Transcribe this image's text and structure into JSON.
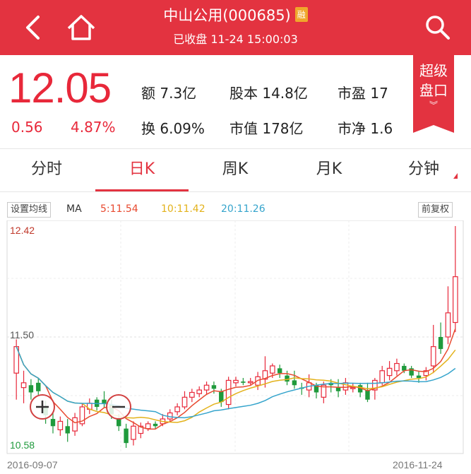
{
  "header": {
    "title": "中山公用(000685)",
    "badge": "融",
    "subtitle": "已收盘 11-24 15:00:03",
    "back_icon": "chevron-left-icon",
    "home_icon": "home-icon",
    "search_icon": "search-icon"
  },
  "quote": {
    "price": "12.05",
    "change": "0.56",
    "change_pct": "4.87%",
    "stats": [
      {
        "label": "额",
        "value": "7.3亿"
      },
      {
        "label": "股本",
        "value": "14.8亿"
      },
      {
        "label": "市盈",
        "value": "17"
      },
      {
        "label": "换",
        "value": "6.09%"
      },
      {
        "label": "市值",
        "value": "178亿"
      },
      {
        "label": "市净",
        "value": "1.6"
      }
    ],
    "super_panel": "超级盘口"
  },
  "tabs": [
    "分时",
    "日K",
    "周K",
    "月K",
    "分钟"
  ],
  "active_tab": "日K",
  "indicators": {
    "settings_button": "设置均线",
    "ma_label": "MA",
    "ma5": "5:11.54",
    "ma10": "10:11.42",
    "ma20": "20:11.26",
    "adjust_button": "前复权"
  },
  "colors": {
    "brand_red": "#e33340",
    "up": "#e8283a",
    "down": "#1f9a3c",
    "ma5": "#e8492f",
    "ma10": "#e3b21b",
    "ma20": "#35a4cc"
  },
  "chart_data": {
    "type": "candlestick",
    "y_ticks": [
      "12.42",
      "11.50",
      "10.58"
    ],
    "ylim": [
      10.58,
      12.42
    ],
    "x_start": "2016-09-07",
    "x_end": "2016-11-24",
    "candles": [
      [
        11.2,
        11.42,
        10.98,
        11.48,
        "up"
      ],
      [
        11.08,
        11.12,
        10.95,
        11.22,
        "up"
      ],
      [
        11.1,
        11.04,
        10.98,
        11.15,
        "down"
      ],
      [
        11.12,
        11.05,
        11.02,
        11.16,
        "down"
      ],
      [
        10.92,
        10.85,
        10.78,
        10.97,
        "down"
      ],
      [
        10.82,
        10.76,
        10.7,
        10.88,
        "down"
      ],
      [
        10.73,
        10.8,
        10.68,
        10.84,
        "up"
      ],
      [
        10.76,
        10.7,
        10.63,
        10.82,
        "down"
      ],
      [
        10.72,
        10.83,
        10.68,
        10.87,
        "up"
      ],
      [
        10.78,
        10.92,
        10.76,
        10.95,
        "up"
      ],
      [
        10.9,
        10.95,
        10.86,
        10.99,
        "up"
      ],
      [
        10.98,
        10.92,
        10.89,
        11.0,
        "down"
      ],
      [
        10.98,
        10.95,
        10.91,
        11.05,
        "down"
      ],
      [
        10.94,
        10.86,
        10.82,
        10.98,
        "down"
      ],
      [
        10.82,
        10.76,
        10.72,
        10.86,
        "down"
      ],
      [
        10.74,
        10.62,
        10.58,
        10.78,
        "down"
      ],
      [
        10.65,
        10.76,
        10.6,
        10.8,
        "up"
      ],
      [
        10.7,
        10.76,
        10.66,
        10.79,
        "up"
      ],
      [
        10.74,
        10.78,
        10.72,
        10.8,
        "up"
      ],
      [
        10.78,
        10.76,
        10.74,
        10.8,
        "down"
      ],
      [
        10.78,
        10.82,
        10.76,
        10.86,
        "up"
      ],
      [
        10.82,
        10.87,
        10.8,
        10.9,
        "up"
      ],
      [
        10.88,
        10.92,
        10.85,
        10.95,
        "up"
      ],
      [
        10.92,
        11.0,
        10.9,
        11.05,
        "up"
      ],
      [
        11.0,
        11.04,
        10.96,
        11.07,
        "up"
      ],
      [
        11.03,
        11.06,
        11.0,
        11.09,
        "up"
      ],
      [
        11.06,
        11.1,
        11.02,
        11.13,
        "up"
      ],
      [
        11.1,
        11.07,
        11.03,
        11.13,
        "down"
      ],
      [
        11.05,
        10.96,
        10.92,
        11.07,
        "down"
      ],
      [
        10.94,
        11.14,
        10.9,
        11.17,
        "up"
      ],
      [
        11.12,
        11.14,
        11.09,
        11.17,
        "up"
      ],
      [
        11.13,
        11.12,
        11.1,
        11.16,
        "down"
      ],
      [
        11.12,
        11.13,
        11.1,
        11.16,
        "up"
      ],
      [
        11.1,
        11.17,
        11.06,
        11.21,
        "up"
      ],
      [
        11.15,
        11.22,
        11.08,
        11.34,
        "up"
      ],
      [
        11.2,
        11.26,
        11.16,
        11.28,
        "up"
      ],
      [
        11.24,
        11.2,
        11.16,
        11.27,
        "down"
      ],
      [
        11.18,
        11.13,
        11.1,
        11.22,
        "down"
      ],
      [
        11.14,
        11.1,
        11.07,
        11.22,
        "down"
      ],
      [
        11.08,
        11.07,
        11.02,
        11.12,
        "down"
      ],
      [
        11.06,
        11.12,
        11.0,
        11.19,
        "up"
      ],
      [
        11.1,
        11.04,
        10.99,
        11.12,
        "down"
      ],
      [
        11.0,
        11.1,
        10.95,
        11.13,
        "up"
      ],
      [
        11.12,
        11.1,
        11.04,
        11.15,
        "down"
      ],
      [
        11.08,
        11.05,
        11.0,
        11.15,
        "down"
      ],
      [
        11.06,
        11.12,
        11.02,
        11.16,
        "up"
      ],
      [
        11.08,
        11.08,
        11.04,
        11.12,
        "up"
      ],
      [
        11.1,
        11.04,
        11.0,
        11.12,
        "down"
      ],
      [
        11.06,
        10.98,
        10.96,
        11.12,
        "down"
      ],
      [
        11.06,
        11.14,
        10.98,
        11.16,
        "up"
      ],
      [
        11.12,
        11.22,
        11.1,
        11.26,
        "up"
      ],
      [
        11.18,
        11.24,
        11.14,
        11.3,
        "up"
      ],
      [
        11.22,
        11.28,
        11.18,
        11.32,
        "up"
      ],
      [
        11.26,
        11.22,
        11.2,
        11.28,
        "down"
      ],
      [
        11.24,
        11.18,
        11.16,
        11.26,
        "down"
      ],
      [
        11.18,
        11.16,
        11.12,
        11.22,
        "down"
      ],
      [
        11.18,
        11.22,
        11.14,
        11.25,
        "up"
      ],
      [
        11.26,
        11.42,
        11.2,
        11.6,
        "up"
      ],
      [
        11.4,
        11.5,
        11.36,
        11.62,
        "down"
      ],
      [
        11.5,
        11.7,
        11.44,
        11.92,
        "up"
      ],
      [
        11.62,
        12.0,
        11.54,
        12.42,
        "up"
      ]
    ]
  }
}
